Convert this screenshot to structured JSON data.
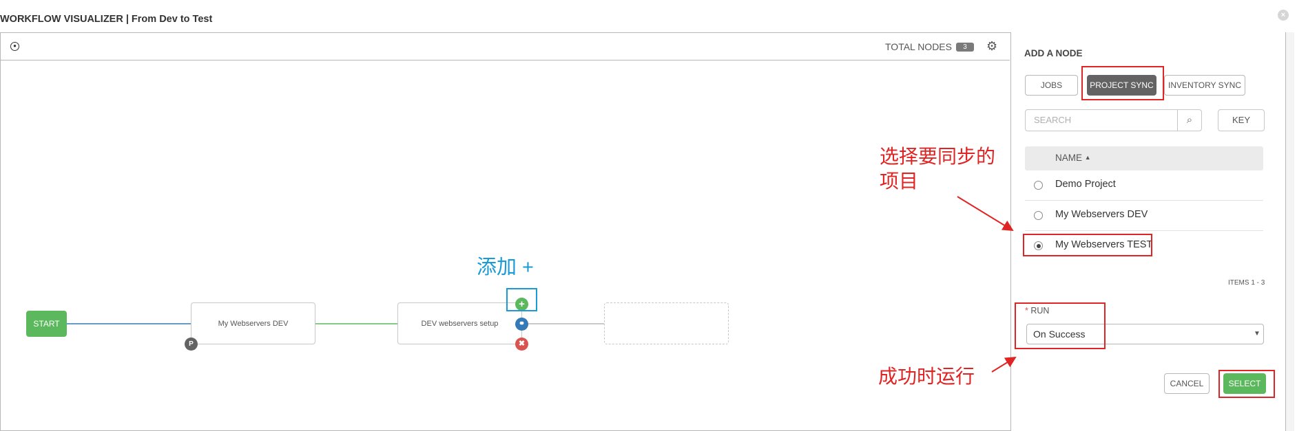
{
  "header": {
    "title": "WORKFLOW VISUALIZER | From Dev to Test",
    "close_icon": "×"
  },
  "toolbar": {
    "total_nodes_label": "TOTAL NODES",
    "total_nodes_count": "3"
  },
  "graph": {
    "start_label": "START",
    "nodes": [
      {
        "label": "My Webservers DEV",
        "badge": "P"
      },
      {
        "label": "DEV webservers setup"
      }
    ],
    "colors": {
      "success": "#5cb85c",
      "always": "#337ab7",
      "failure": "#d9534f"
    }
  },
  "annotations": {
    "add": "添加 +",
    "choose_project": [
      "选择要同步的",
      "项目"
    ],
    "run_on_success": "成功时运行"
  },
  "panel": {
    "title": "ADD A NODE",
    "tabs": [
      {
        "label": "JOBS"
      },
      {
        "label": "PROJECT SYNC",
        "active": true
      },
      {
        "label": "INVENTORY SYNC"
      }
    ],
    "search": {
      "placeholder": "SEARCH"
    },
    "key_label": "KEY",
    "column_name": "NAME",
    "sort_icon": "▲",
    "rows": [
      {
        "name": "Demo Project",
        "selected": false
      },
      {
        "name": "My Webservers DEV",
        "selected": false
      },
      {
        "name": "My Webservers TEST",
        "selected": true
      }
    ],
    "items_label": "ITEMS  1 - 3",
    "run": {
      "required_mark": "*",
      "label": "RUN",
      "value": "On Success"
    },
    "cancel_label": "CANCEL",
    "select_label": "SELECT"
  }
}
